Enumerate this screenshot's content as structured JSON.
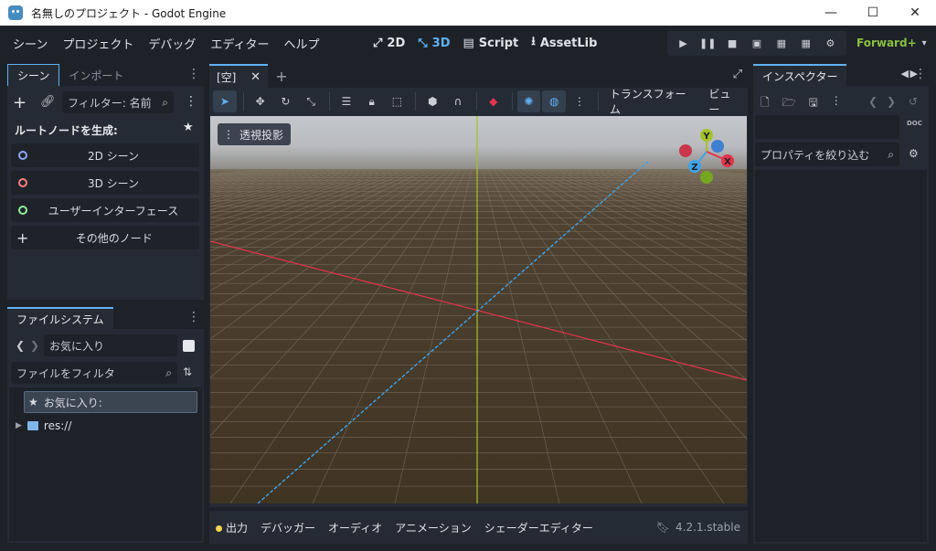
{
  "window": {
    "title": "名無しのプロジェクト - Godot Engine",
    "min": "—",
    "max": "☐",
    "close": "✕"
  },
  "menu": [
    "シーン",
    "プロジェクト",
    "デバッグ",
    "エディター",
    "ヘルプ"
  ],
  "main_tabs": [
    {
      "label": "2D",
      "icon": "2d-icon"
    },
    {
      "label": "3D",
      "icon": "3d-icon",
      "active": true
    },
    {
      "label": "Script",
      "icon": "script-icon"
    },
    {
      "label": "AssetLib",
      "icon": "assetlib-icon"
    }
  ],
  "renderer": "Forward+",
  "scene_dock": {
    "tabs": [
      "シーン",
      "インポート"
    ],
    "filter_placeholder": "フィルター: 名前",
    "create_root_label": "ルートノードを生成:",
    "buttons": [
      {
        "label": "2D シーン",
        "color": "#8da5f3"
      },
      {
        "label": "3D シーン",
        "color": "#fc7f7f"
      },
      {
        "label": "ユーザーインターフェース",
        "color": "#8eef97"
      },
      {
        "label": "その他のノード"
      }
    ]
  },
  "filesystem": {
    "tab": "ファイルシステム",
    "path": "お気に入り",
    "filter_placeholder": "ファイルをフィルタ",
    "favorites": "お気に入り:",
    "res": "res://"
  },
  "viewport": {
    "doc_tab": "[空]",
    "toolbar_text": [
      "トランスフォーム",
      "ビュー"
    ],
    "perspective": "透視投影",
    "gizmo": {
      "y": "Y",
      "x": "X",
      "z": "Z"
    }
  },
  "bottom_tabs": [
    "出力",
    "デバッガー",
    "オーディオ",
    "アニメーション",
    "シェーダーエディター"
  ],
  "version": "4.2.1.stable",
  "inspector": {
    "tab": "インスペクター",
    "filter_placeholder": "プロパティを絞り込む",
    "doc": "DOC"
  },
  "colors": {
    "accent": "#5fb2f5",
    "renderer": "#8ac03e",
    "x_axis": "#e5334b",
    "y_axis": "#8ac03e",
    "z_axis": "#3fa3e8"
  }
}
